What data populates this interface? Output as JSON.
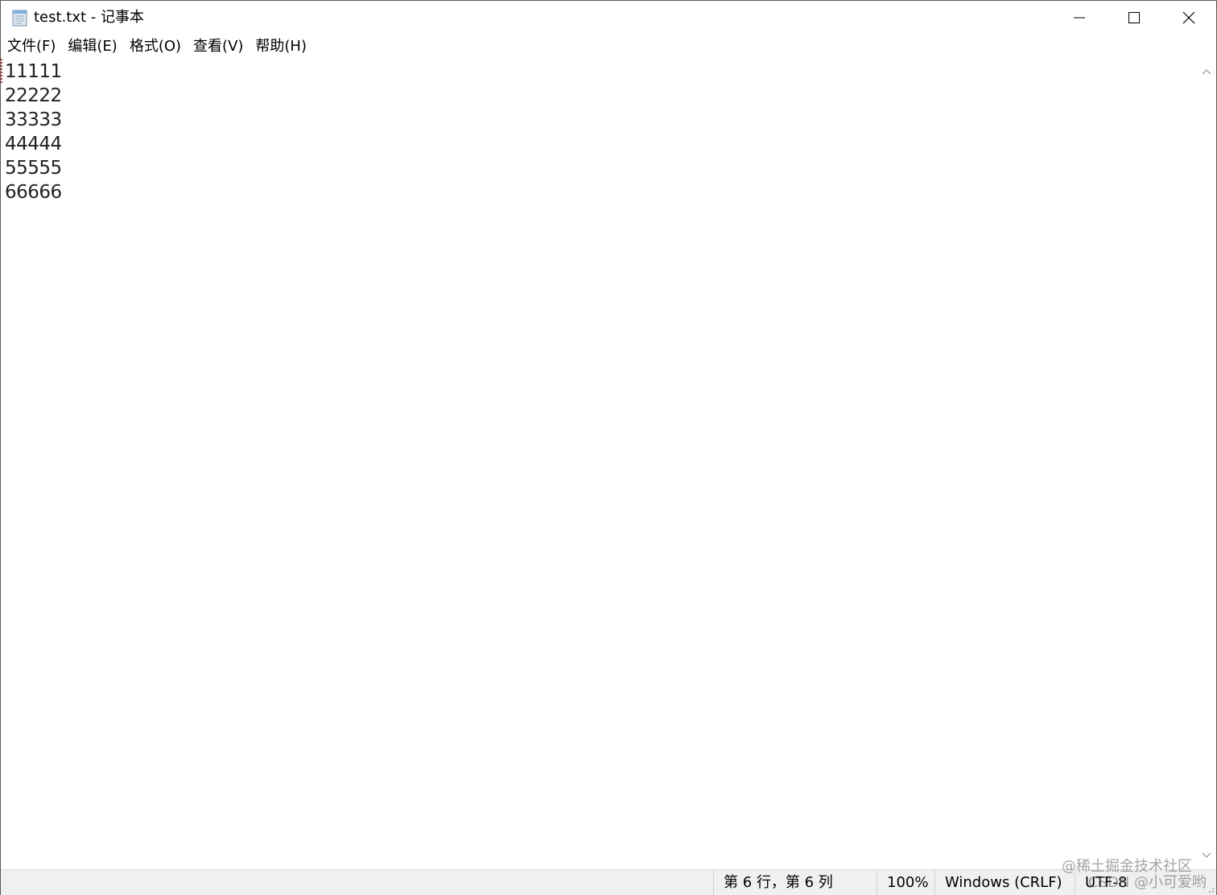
{
  "window": {
    "title": "test.txt - 记事本",
    "controls": {
      "minimize_icon": "minimize-icon",
      "maximize_icon": "maximize-icon",
      "close_icon": "close-icon"
    }
  },
  "menubar": {
    "items": [
      "文件(F)",
      "编辑(E)",
      "格式(O)",
      "查看(V)",
      "帮助(H)"
    ]
  },
  "editor": {
    "lines": [
      "11111",
      "22222",
      "33333",
      "44444",
      "55555",
      "66666"
    ]
  },
  "statusbar": {
    "position": "第 6 行，第 6 列",
    "zoom": "100%",
    "line_ending": "Windows (CRLF)",
    "encoding": "UTF-8"
  },
  "watermark": {
    "line1": "@稀土掘金技术社区",
    "line2": "CSDN @小可爱哟"
  }
}
